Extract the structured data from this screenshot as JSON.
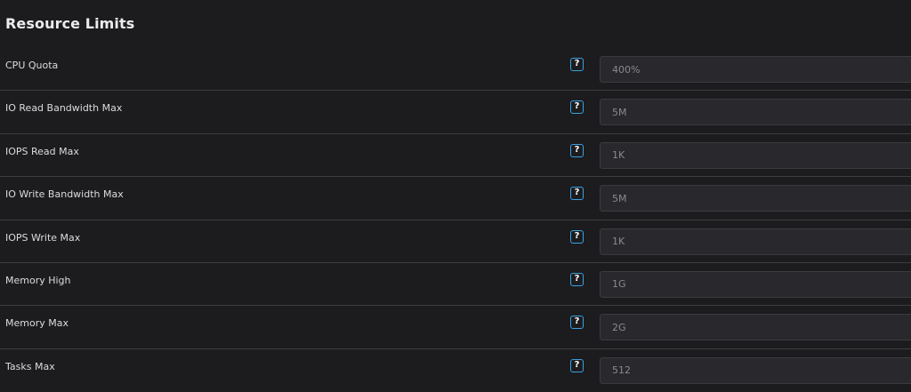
{
  "section": {
    "title": "Resource Limits"
  },
  "help_icon_glyph": "?",
  "colors": {
    "background": "#1c1c1f",
    "input_background": "#29292d",
    "help_icon_accent": "#3aa0e0",
    "divider": "#3c3c42"
  },
  "fields": [
    {
      "label": "CPU Quota",
      "placeholder": "400%",
      "value": ""
    },
    {
      "label": "IO Read Bandwidth Max",
      "placeholder": "5M",
      "value": ""
    },
    {
      "label": "IOPS Read Max",
      "placeholder": "1K",
      "value": ""
    },
    {
      "label": "IO Write Bandwidth Max",
      "placeholder": "5M",
      "value": ""
    },
    {
      "label": "IOPS Write Max",
      "placeholder": "1K",
      "value": ""
    },
    {
      "label": "Memory High",
      "placeholder": "1G",
      "value": ""
    },
    {
      "label": "Memory Max",
      "placeholder": "2G",
      "value": ""
    },
    {
      "label": "Tasks Max",
      "placeholder": "512",
      "value": ""
    }
  ]
}
